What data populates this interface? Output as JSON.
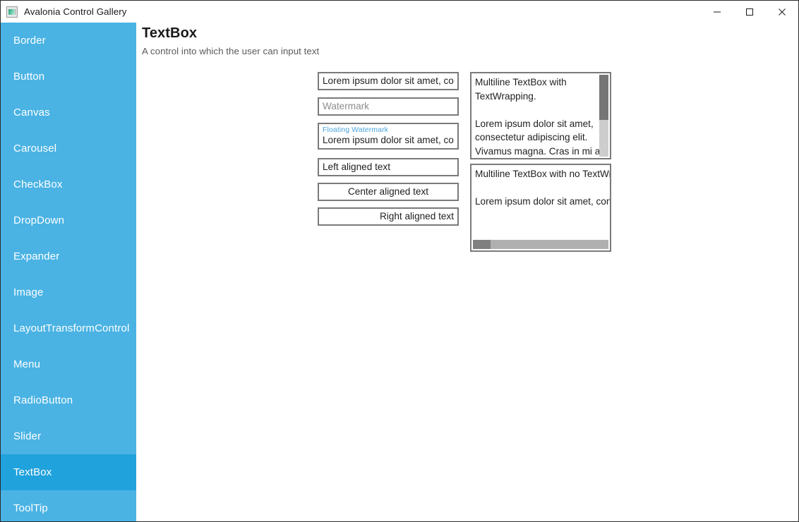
{
  "window": {
    "title": "Avalonia Control Gallery",
    "icon": "app-window-icon",
    "controls": [
      {
        "name": "minimize",
        "glyph": "minimize-icon"
      },
      {
        "name": "maximize",
        "glyph": "maximize-icon"
      },
      {
        "name": "close",
        "glyph": "close-icon"
      }
    ]
  },
  "colors": {
    "sidebar_bg": "#4ab3e4",
    "sidebar_selected_bg": "#20a2dd",
    "sidebar_text": "#ffffff",
    "accent": "#4aa3dd",
    "textbox_border": "#7a7a7a",
    "scrollbar_thumb": "#767676",
    "scrollbar_track": "#cdcdcd",
    "title_text": "#1a1a1a",
    "subtitle_text": "#5a5a5a",
    "placeholder_text": "#8d8d8d"
  },
  "sidebar": {
    "selected": "TextBox",
    "items": [
      {
        "label": "Border"
      },
      {
        "label": "Button"
      },
      {
        "label": "Canvas"
      },
      {
        "label": "Carousel"
      },
      {
        "label": "CheckBox"
      },
      {
        "label": "DropDown"
      },
      {
        "label": "Expander"
      },
      {
        "label": "Image"
      },
      {
        "label": "LayoutTransformControl"
      },
      {
        "label": "Menu"
      },
      {
        "label": "RadioButton"
      },
      {
        "label": "Slider"
      },
      {
        "label": "TextBox"
      },
      {
        "label": "ToolTip"
      }
    ]
  },
  "page": {
    "title": "TextBox",
    "subtitle": "A control into which the user can input text"
  },
  "textboxes": {
    "basic": {
      "value": "Lorem ipsum dolor sit amet, consec"
    },
    "watermark": {
      "value": "",
      "placeholder": "Watermark"
    },
    "floating_watermark": {
      "label": "Floating Watermark",
      "value": "Lorem ipsum dolor sit amet, consec"
    },
    "left_aligned": {
      "value": "Left aligned text"
    },
    "center_aligned": {
      "value": "Center aligned text"
    },
    "right_aligned": {
      "value": "Right aligned text"
    },
    "multiline_wrap": {
      "value": "Multiline TextBox with\nTextWrapping.\n\nLorem ipsum dolor sit amet,\nconsectetur adipiscing elit.\nVivamus magna. Cras in mi at\nfelis aliquet congue. Ut a est eget",
      "scrollbar": "vertical",
      "thumb_percent": 55
    },
    "multiline_nowrap": {
      "value": "Multiline TextBox with no TextWrapp\n\nLorem ipsum dolor sit amet, consec",
      "scrollbar": "horizontal",
      "thumb_percent": 13
    }
  }
}
